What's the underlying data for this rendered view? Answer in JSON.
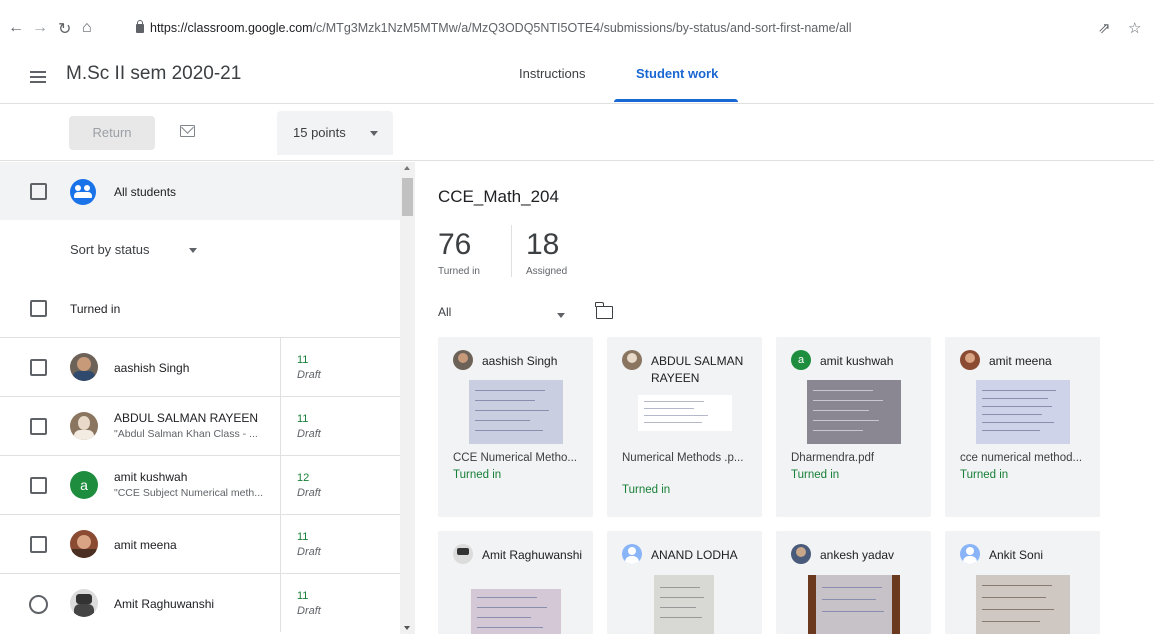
{
  "browser": {
    "url_host": "https://classroom.google.com",
    "url_path": "/c/MTg3Mzk1NzM5MTMw/a/MzQ3ODQ5NTI5OTE4/submissions/by-status/and-sort-first-name/all"
  },
  "header": {
    "class_name": "M.Sc II sem 2020-21",
    "tabs": [
      {
        "label": "Instructions"
      },
      {
        "label": "Student work"
      }
    ]
  },
  "toolbar": {
    "return_label": "Return",
    "points_value": "15 points"
  },
  "left": {
    "all_students_label": "All students",
    "sort_label": "Sort by status",
    "group_header": "Turned in",
    "students": [
      {
        "name": "aashish Singh",
        "comment": "",
        "grade": "11",
        "status": "Draft"
      },
      {
        "name": "ABDUL SALMAN RAYEEN",
        "comment": "\"Abdul Salman Khan Class - ...",
        "grade": "11",
        "status": "Draft"
      },
      {
        "name": "amit kushwah",
        "comment": "\"CCE Subject Numerical meth...",
        "grade": "12",
        "status": "Draft"
      },
      {
        "name": "amit meena",
        "comment": "",
        "grade": "11",
        "status": "Draft"
      },
      {
        "name": "Amit Raghuwanshi",
        "comment": "",
        "grade": "11",
        "status": "Draft"
      }
    ]
  },
  "right": {
    "assignment_title": "CCE_Math_204",
    "turned_in_count": "76",
    "turned_in_label": "Turned in",
    "assigned_count": "18",
    "assigned_label": "Assigned",
    "filter_value": "All",
    "cards": [
      {
        "name": "aashish Singh",
        "file": "CCE Numerical Metho...",
        "status": "Turned in"
      },
      {
        "name": "ABDUL SALMAN RAYEEN",
        "file": "Numerical Methods .p...",
        "status": "Turned in"
      },
      {
        "name": "amit kushwah",
        "avatar_letter": "a",
        "file": "Dharmendra.pdf",
        "status": "Turned in"
      },
      {
        "name": "amit meena",
        "file": "cce numerical method...",
        "status": "Turned in"
      },
      {
        "name": "Amit Raghuwanshi",
        "file": "",
        "status": ""
      },
      {
        "name": "ANAND LODHA",
        "file": "",
        "status": ""
      },
      {
        "name": "ankesh yadav",
        "file": "",
        "status": ""
      },
      {
        "name": "Ankit Soni",
        "file": "",
        "status": ""
      }
    ]
  },
  "left_avatar_letter": "a",
  "colors": {
    "accent": "#1967d2",
    "turned_in": "#188038"
  }
}
